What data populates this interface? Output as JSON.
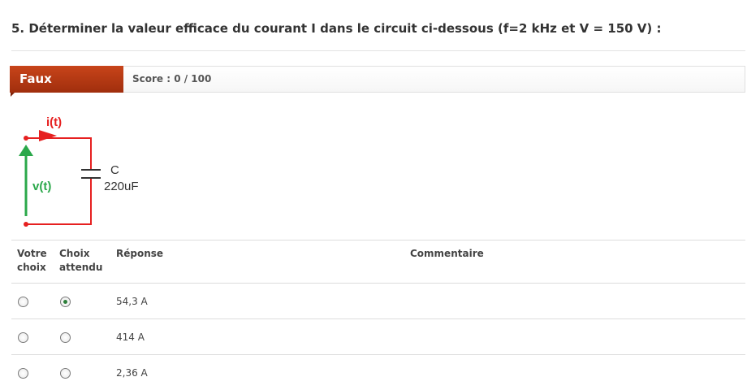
{
  "question": {
    "title": "5. Déterminer la valeur efficace du courant I dans le circuit ci-dessous (f=2 kHz et V = 150 V) :"
  },
  "result": {
    "status": "Faux",
    "score": "Score : 0 / 100"
  },
  "circuit": {
    "current_label": "i(t)",
    "voltage_label": "v(t)",
    "capacitor_name": "C",
    "capacitor_value": "220uF",
    "colors": {
      "current": "#e62020",
      "voltage": "#2aa84a",
      "wire": "#e62020"
    }
  },
  "table": {
    "headers": {
      "your_choice": [
        "Votre",
        "choix"
      ],
      "expected": [
        "Choix",
        "attendu"
      ],
      "answer": "Réponse",
      "comment": "Commentaire"
    },
    "rows": [
      {
        "answer": "54,3 A",
        "your_choice": false,
        "expected": true,
        "comment": ""
      },
      {
        "answer": "414 A",
        "your_choice": false,
        "expected": false,
        "comment": ""
      },
      {
        "answer": "2,36 A",
        "your_choice": false,
        "expected": false,
        "comment": ""
      }
    ]
  }
}
